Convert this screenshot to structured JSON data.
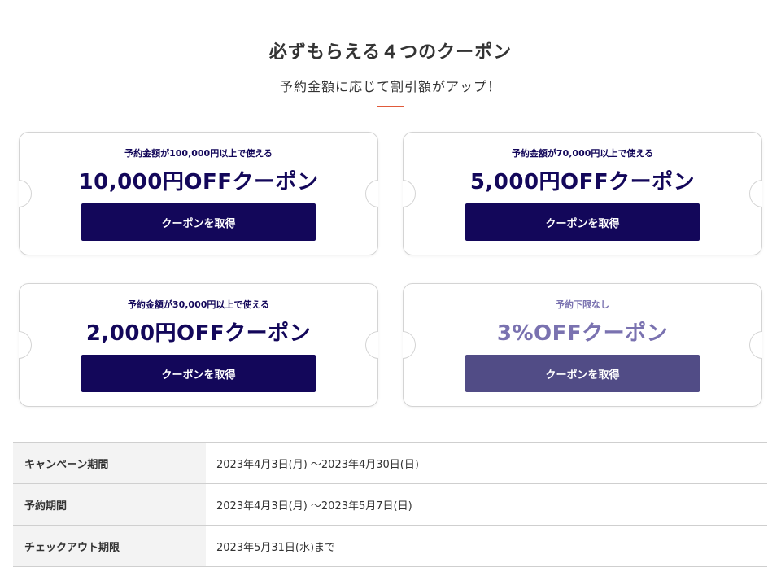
{
  "header": {
    "title": "必ずもらえる４つのクーポン",
    "subtitle": "予約金額に応じて割引額がアップ！"
  },
  "colors": {
    "accent_line": "#e05a3a",
    "navy": "#13075a",
    "muted_purple": "#7a72b0",
    "muted_button": "#514c86"
  },
  "coupons": [
    {
      "condition": "予約金額が100,000円以上で使える",
      "title": "10,000円OFFクーポン",
      "button_label": "クーポンを取得"
    },
    {
      "condition": "予約金額が70,000円以上で使える",
      "title": "5,000円OFFクーポン",
      "button_label": "クーポンを取得"
    },
    {
      "condition": "予約金額が30,000円以上で使える",
      "title": "2,000円OFFクーポン",
      "button_label": "クーポンを取得"
    },
    {
      "condition": "予約下限なし",
      "title": "3%OFFクーポン",
      "button_label": "クーポンを取得"
    }
  ],
  "info_table": [
    {
      "label": "キャンペーン期間",
      "value": "2023年4月3日(月) 〜2023年4月30日(日)"
    },
    {
      "label": "予約期間",
      "value": "2023年4月3日(月) 〜2023年5月7日(日)"
    },
    {
      "label": "チェックアウト期限",
      "value": "2023年5月31日(水)まで"
    }
  ]
}
